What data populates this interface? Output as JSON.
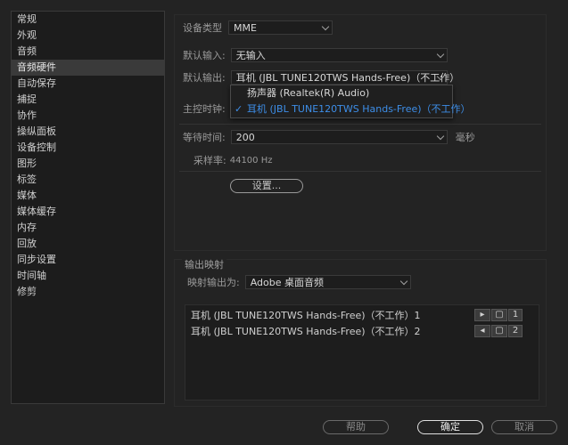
{
  "sidebar": {
    "items": [
      {
        "label": "常规"
      },
      {
        "label": "外观"
      },
      {
        "label": "音频"
      },
      {
        "label": "音频硬件",
        "active": true
      },
      {
        "label": "自动保存"
      },
      {
        "label": "捕捉"
      },
      {
        "label": "协作"
      },
      {
        "label": "操纵面板"
      },
      {
        "label": "设备控制"
      },
      {
        "label": "图形"
      },
      {
        "label": "标签"
      },
      {
        "label": "媒体"
      },
      {
        "label": "媒体缓存"
      },
      {
        "label": "内存"
      },
      {
        "label": "回放"
      },
      {
        "label": "同步设置"
      },
      {
        "label": "时间轴"
      },
      {
        "label": "修剪"
      }
    ]
  },
  "device": {
    "type_label": "设备类型",
    "type_value": "MME",
    "input_label": "默认输入:",
    "input_value": "无输入",
    "output_label": "默认输出:",
    "output_value": "耳机 (JBL TUNE120TWS Hands-Free)（不工作）",
    "master_clock_label": "主控时钟:",
    "wait_label": "等待时间:",
    "wait_value": "200",
    "wait_unit": "毫秒",
    "sample_rate_label": "采样率:",
    "sample_rate_value": "44100 Hz",
    "settings_button": "设置..."
  },
  "output_dropdown": {
    "options": [
      {
        "label": "扬声器 (Realtek(R) Audio)",
        "selected": false
      },
      {
        "label": "耳机 (JBL TUNE120TWS Hands-Free)（不工作）",
        "selected": true
      }
    ],
    "check": "✓"
  },
  "output_mapping": {
    "title": "输出映射",
    "map_label": "映射输出为:",
    "map_value": "Adobe 桌面音频",
    "rows": [
      {
        "label": "耳机 (JBL TUNE120TWS Hands-Free)（不工作）1",
        "channel": "1"
      },
      {
        "label": "耳机 (JBL TUNE120TWS Hands-Free)（不工作）2",
        "channel": "2"
      }
    ]
  },
  "footer": {
    "help": "帮助",
    "ok": "确定",
    "cancel": "取消"
  },
  "colors": {
    "accent": "#3d8ee8",
    "background": "#232323"
  }
}
